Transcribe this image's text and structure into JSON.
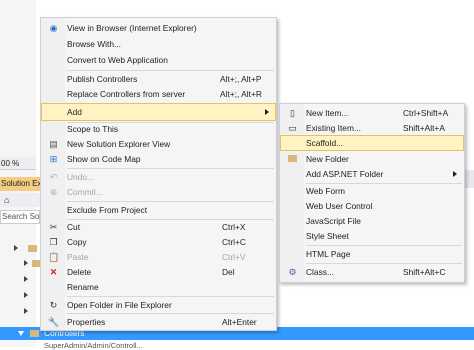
{
  "background": {
    "zoom": "00 %",
    "solution_explorer_title": "Solution Exp",
    "search_placeholder": "Search Solu",
    "selected_node": "Controllers",
    "bottom_partial": "SuperAdmin/Admin/Controll..."
  },
  "context_menu": {
    "items": [
      {
        "label": "View in Browser (Internet Explorer)",
        "shortcut": "",
        "icon": "browser-icon"
      },
      {
        "label": "Browse With...",
        "shortcut": "",
        "icon": ""
      },
      {
        "label": "Convert to Web Application",
        "shortcut": "",
        "icon": ""
      },
      {
        "label": "Publish Controllers",
        "shortcut": "Alt+;, Alt+P",
        "icon": ""
      },
      {
        "label": "Replace Controllers from server",
        "shortcut": "Alt+;, Alt+R",
        "icon": ""
      },
      {
        "label": "Add",
        "shortcut": "",
        "icon": ""
      },
      {
        "label": "Scope to This",
        "shortcut": "",
        "icon": ""
      },
      {
        "label": "New Solution Explorer View",
        "shortcut": "",
        "icon": "new-view-icon"
      },
      {
        "label": "Show on Code Map",
        "shortcut": "",
        "icon": "code-map-icon"
      },
      {
        "label": "Undo...",
        "shortcut": "",
        "icon": "undo-icon"
      },
      {
        "label": "Commit...",
        "shortcut": "",
        "icon": "commit-icon"
      },
      {
        "label": "Exclude From Project",
        "shortcut": "",
        "icon": ""
      },
      {
        "label": "Cut",
        "shortcut": "Ctrl+X",
        "icon": "cut-icon"
      },
      {
        "label": "Copy",
        "shortcut": "Ctrl+C",
        "icon": "copy-icon"
      },
      {
        "label": "Paste",
        "shortcut": "Ctrl+V",
        "icon": "paste-icon"
      },
      {
        "label": "Delete",
        "shortcut": "Del",
        "icon": "delete-icon"
      },
      {
        "label": "Rename",
        "shortcut": "",
        "icon": ""
      },
      {
        "label": "Open Folder in File Explorer",
        "shortcut": "",
        "icon": "open-folder-icon"
      },
      {
        "label": "Properties",
        "shortcut": "Alt+Enter",
        "icon": "wrench-icon"
      }
    ]
  },
  "add_submenu": {
    "items": [
      {
        "label": "New Item...",
        "shortcut": "Ctrl+Shift+A",
        "icon": "new-item-icon"
      },
      {
        "label": "Existing Item...",
        "shortcut": "Shift+Alt+A",
        "icon": "existing-item-icon"
      },
      {
        "label": "Scaffold...",
        "shortcut": "",
        "icon": ""
      },
      {
        "label": "New Folder",
        "shortcut": "",
        "icon": "new-folder-icon"
      },
      {
        "label": "Add ASP.NET Folder",
        "shortcut": "",
        "icon": ""
      },
      {
        "label": "Web Form",
        "shortcut": "",
        "icon": ""
      },
      {
        "label": "Web User Control",
        "shortcut": "",
        "icon": ""
      },
      {
        "label": "JavaScript File",
        "shortcut": "",
        "icon": ""
      },
      {
        "label": "Style Sheet",
        "shortcut": "",
        "icon": ""
      },
      {
        "label": "HTML Page",
        "shortcut": "",
        "icon": ""
      },
      {
        "label": "Class...",
        "shortcut": "Shift+Alt+C",
        "icon": "class-icon"
      }
    ]
  },
  "colors": {
    "highlight": "#fff3c4",
    "selection": "#3399ff",
    "menu_bg": "#f5f5f5"
  }
}
